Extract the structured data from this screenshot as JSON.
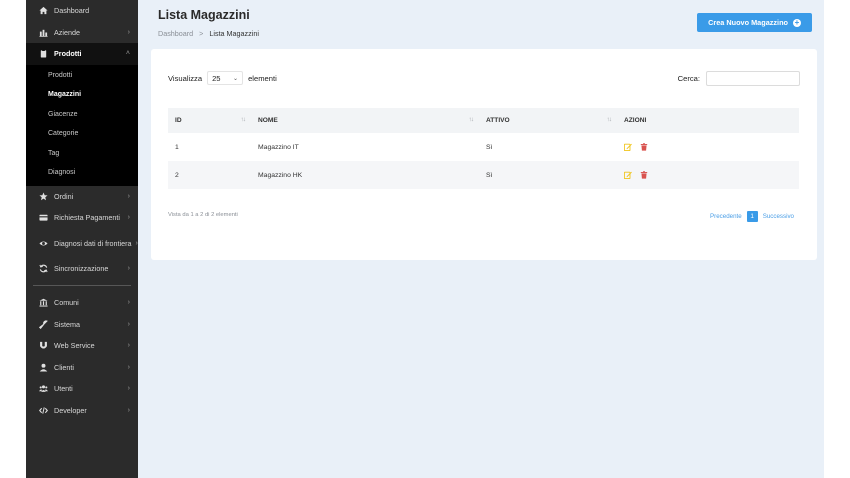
{
  "sidebar": {
    "items": [
      {
        "label": "Dashboard",
        "icon": "home-icon",
        "chevron": ""
      },
      {
        "label": "Aziende",
        "icon": "chart-icon",
        "chevron": "›"
      },
      {
        "label": "Prodotti",
        "icon": "clipboard-icon",
        "chevron": "˄"
      }
    ],
    "submenu": [
      "Prodotti",
      "Magazzini",
      "Giacenze",
      "Categorie",
      "Tag",
      "Diagnosi"
    ],
    "items_after": [
      {
        "label": "Ordini",
        "icon": "star-icon",
        "chevron": "›"
      },
      {
        "label": "Richiesta Pagamenti",
        "icon": "credit-card-icon",
        "chevron": "›"
      },
      {
        "label": "Diagnosi dati di frontiera",
        "icon": "eye-icon",
        "chevron": "›"
      },
      {
        "label": "Sincronizzazione",
        "icon": "sync-icon",
        "chevron": "›"
      }
    ],
    "items_bottom": [
      {
        "label": "Comuni",
        "icon": "building-icon",
        "chevron": "›"
      },
      {
        "label": "Sistema",
        "icon": "wrench-icon",
        "chevron": "›"
      },
      {
        "label": "Web Service",
        "icon": "shield-icon",
        "chevron": "›"
      },
      {
        "label": "Clienti",
        "icon": "user-icon",
        "chevron": "›"
      },
      {
        "label": "Utenti",
        "icon": "users-icon",
        "chevron": "›"
      },
      {
        "label": "Developer",
        "icon": "code-icon",
        "chevron": "›"
      }
    ]
  },
  "header": {
    "title": "Lista Magazzini",
    "breadcrumb_root": "Dashboard",
    "breadcrumb_sep": ">",
    "breadcrumb_current": "Lista Magazzini",
    "create_button": "Crea Nuovo Magazzino"
  },
  "table_controls": {
    "show_label": "Visualizza",
    "page_size": "25",
    "entries_label": "elementi",
    "search_label": "Cerca:",
    "search_value": ""
  },
  "table": {
    "columns": [
      "ID",
      "NOME",
      "ATTIVO",
      "AZIONI"
    ],
    "rows": [
      {
        "id": "1",
        "nome": "Magazzino IT",
        "attivo": "Sì"
      },
      {
        "id": "2",
        "nome": "Magazzino HK",
        "attivo": "Sì"
      }
    ]
  },
  "footer": {
    "info": "Vista da 1 a 2 di 2 elementi",
    "prev": "Precedente",
    "page": "1",
    "next": "Successivo"
  },
  "colors": {
    "sidebar_bg": "#2b2b2b",
    "main_bg": "#e9f0f8",
    "accent": "#3a9be8",
    "edit_icon": "#f0c419",
    "delete_icon": "#d9534f"
  }
}
